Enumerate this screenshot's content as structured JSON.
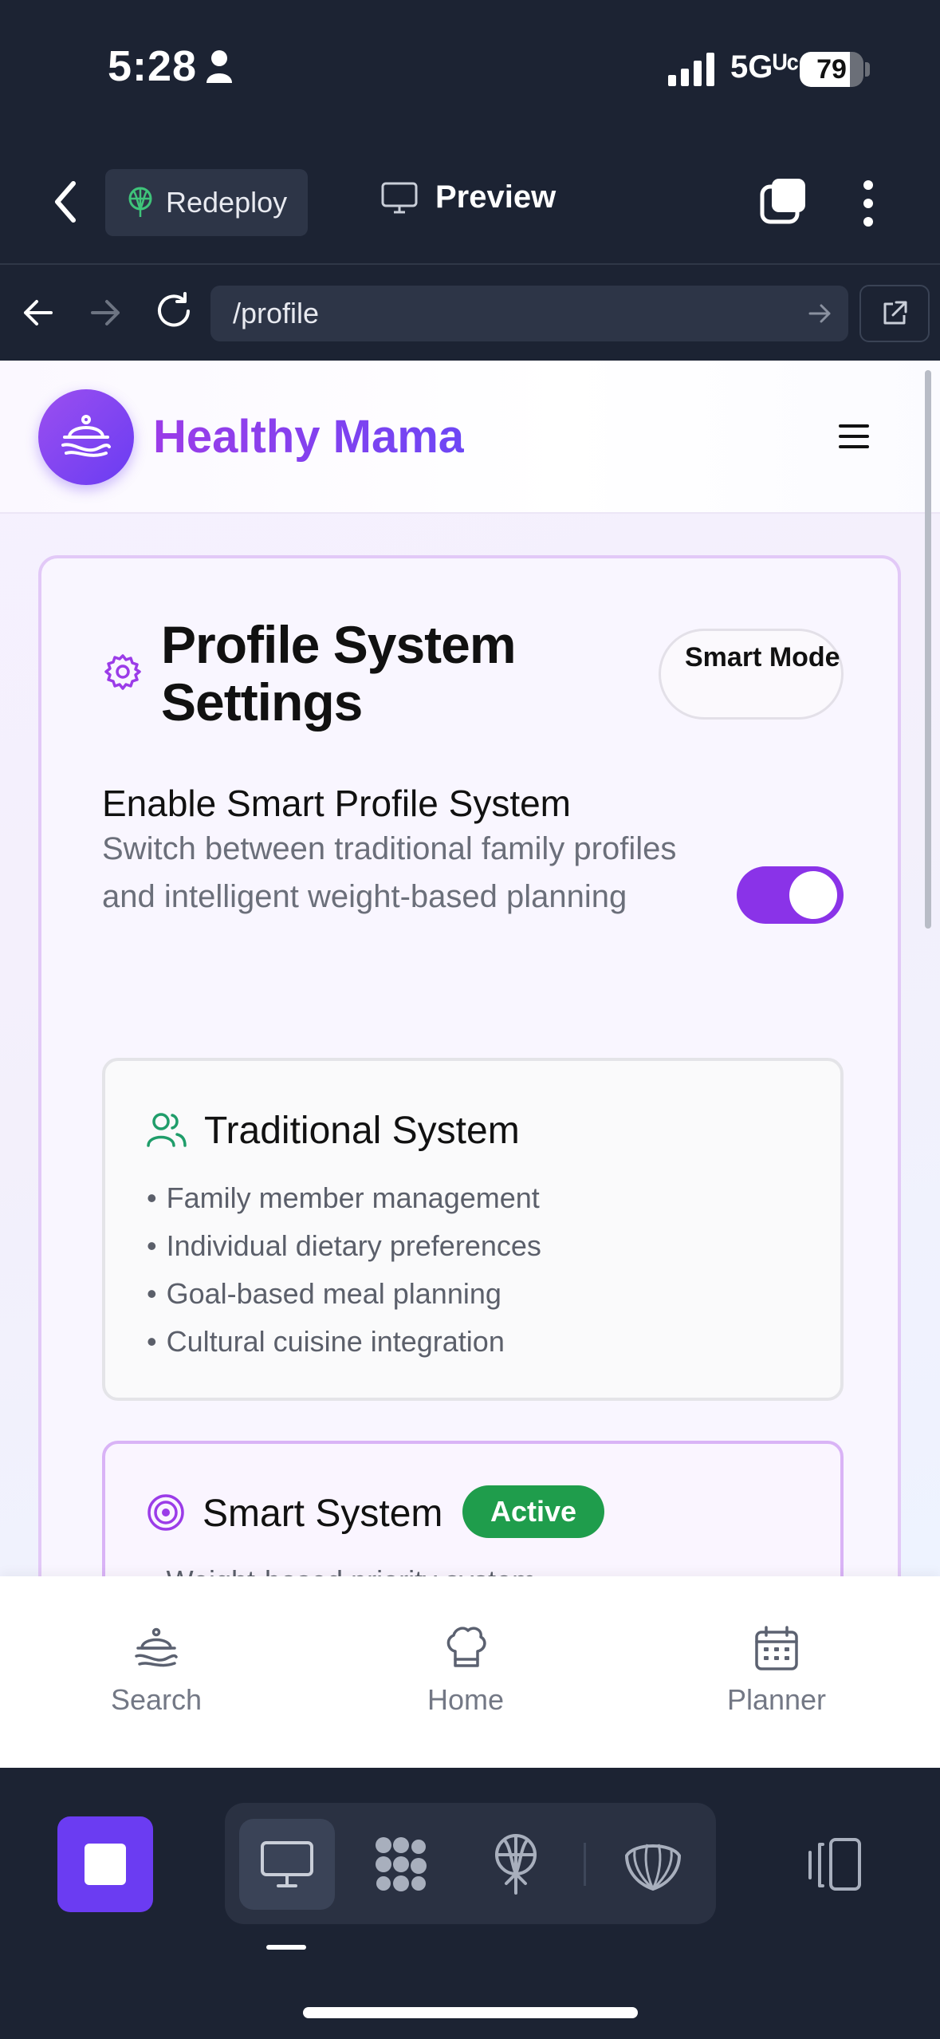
{
  "status_bar": {
    "time": "5:28",
    "network": "5Gᵁᶜ",
    "battery": "79",
    "battery_level": 0.79
  },
  "app_toolbar": {
    "redeploy_label": "Redeploy",
    "preview_label": "Preview"
  },
  "url_bar": {
    "path": "/profile"
  },
  "site": {
    "name": "Healthy Mama"
  },
  "settings_card": {
    "title": "Profile System Settings",
    "badge": "Smart Mode",
    "toggle": {
      "heading": "Enable Smart Profile System",
      "description": "Switch between traditional family profiles and intelligent weight-based planning",
      "enabled": true
    },
    "traditional": {
      "title": "Traditional System",
      "features": [
        "Family member management",
        "Individual dietary preferences",
        "Goal-based meal planning",
        "Cultural cuisine integration"
      ]
    },
    "smart": {
      "title": "Smart System",
      "status": "Active",
      "features": [
        "Weight-based priority system"
      ]
    }
  },
  "bottom_nav": {
    "items": [
      {
        "label": "Search",
        "icon": "bowl-icon"
      },
      {
        "label": "Home",
        "icon": "chef-hat-icon"
      },
      {
        "label": "Planner",
        "icon": "calendar-icon"
      }
    ]
  },
  "colors": {
    "accent": "#8a33e8",
    "active_green": "#1f9d4c",
    "toolbar_bg": "#1c2333"
  }
}
